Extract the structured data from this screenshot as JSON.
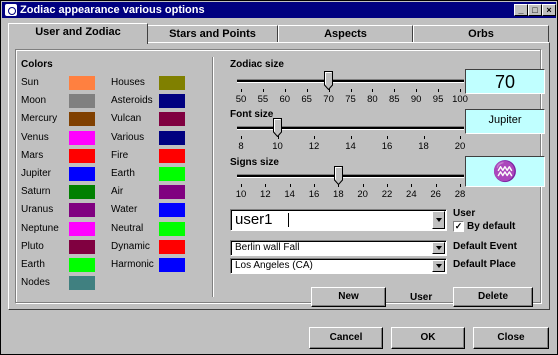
{
  "window": {
    "title": "Zodiac appearance various options",
    "controls": {
      "minimize": "_",
      "maximize": "□",
      "close": "×"
    }
  },
  "tabs": [
    {
      "label": "User and Zodiac",
      "active": true
    },
    {
      "label": "Stars and Points",
      "active": false
    },
    {
      "label": "Aspects",
      "active": false
    },
    {
      "label": "Orbs",
      "active": false
    }
  ],
  "colors": {
    "heading": "Colors",
    "left": [
      {
        "label": "Sun",
        "color": "#ff8040"
      },
      {
        "label": "Moon",
        "color": "#808080"
      },
      {
        "label": "Mercury",
        "color": "#804000"
      },
      {
        "label": "Venus",
        "color": "#ff00ff"
      },
      {
        "label": "Mars",
        "color": "#ff0000"
      },
      {
        "label": "Jupiter",
        "color": "#0000ff"
      },
      {
        "label": "Saturn",
        "color": "#008000"
      },
      {
        "label": "Uranus",
        "color": "#800080"
      },
      {
        "label": "Neptune",
        "color": "#ff00ff"
      },
      {
        "label": "Pluto",
        "color": "#800040"
      },
      {
        "label": "Earth",
        "color": "#00ff00"
      },
      {
        "label": "Nodes",
        "color": "#408080"
      }
    ],
    "right": [
      {
        "label": "Houses",
        "color": "#808000"
      },
      {
        "label": "Asteroids",
        "color": "#000080"
      },
      {
        "label": "Vulcan",
        "color": "#800040"
      },
      {
        "label": "Various",
        "color": "#000080"
      },
      {
        "label": "Fire",
        "color": "#ff0000"
      },
      {
        "label": "Earth",
        "color": "#00ff00"
      },
      {
        "label": "Air",
        "color": "#800080"
      },
      {
        "label": "Water",
        "color": "#0000ff"
      },
      {
        "label": "Neutral",
        "color": "#00ff00"
      },
      {
        "label": "Dynamic",
        "color": "#ff0000"
      },
      {
        "label": "Harmonic",
        "color": "#0000ff"
      }
    ]
  },
  "sliders": {
    "zodiac_size": {
      "label": "Zodiac size",
      "ticks": [
        "50",
        "55",
        "60",
        "65",
        "70",
        "75",
        "80",
        "85",
        "90",
        "95",
        "100"
      ],
      "min": 50,
      "max": 100,
      "value": 70,
      "display": "70"
    },
    "font_size": {
      "label": "Font size",
      "ticks": [
        "8",
        "10",
        "12",
        "14",
        "16",
        "18",
        "20"
      ],
      "min": 8,
      "max": 20,
      "value": 10,
      "display": "Jupiter"
    },
    "signs_size": {
      "label": "Signs size",
      "ticks": [
        "10",
        "12",
        "14",
        "16",
        "18",
        "20",
        "22",
        "24",
        "26",
        "28"
      ],
      "min": 10,
      "max": 28,
      "value": 18,
      "display": "♒"
    }
  },
  "user": {
    "value": "user1",
    "label": "User",
    "by_default_label": "By default",
    "by_default_checked": true
  },
  "default_event": {
    "value": "Berlin wall Fall",
    "label": "Default Event"
  },
  "default_place": {
    "value": "Los Angeles (CA)",
    "label": "Default Place"
  },
  "user_buttons": {
    "new": "New",
    "user_label": "User",
    "delete": "Delete"
  },
  "footer": {
    "cancel": "Cancel",
    "ok": "OK",
    "close": "Close"
  }
}
